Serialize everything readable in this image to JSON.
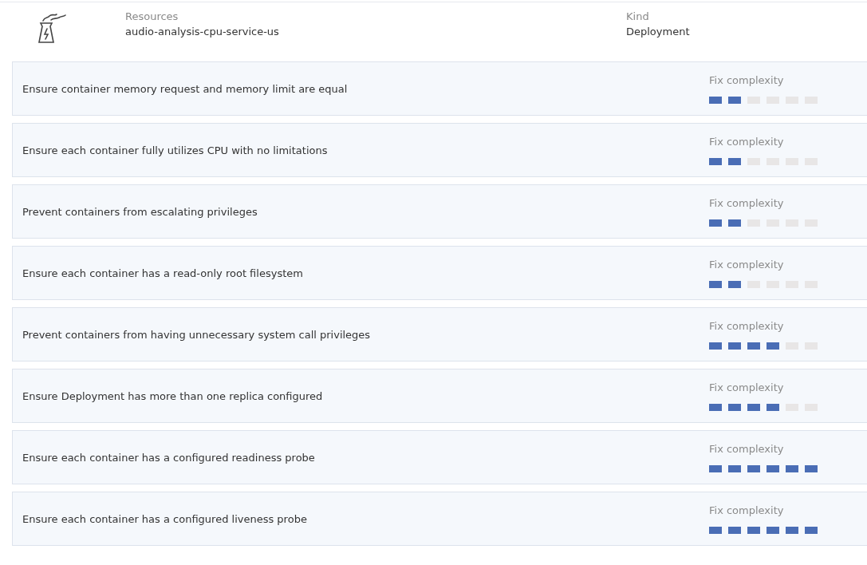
{
  "resource": {
    "label": "Resources",
    "value": "audio-analysis-cpu-service-us"
  },
  "kind": {
    "label": "Kind",
    "value": "Deployment"
  },
  "checks": [
    {
      "title": "Ensure container memory request and memory limit are equal",
      "complexity_label": "Fix complexity",
      "level": 0.3333
    },
    {
      "title": "Ensure each container fully utilizes CPU with no limitations",
      "complexity_label": "Fix complexity",
      "level": 0.3333
    },
    {
      "title": "Prevent containers from escalating privileges",
      "complexity_label": "Fix complexity",
      "level": 0.3333
    },
    {
      "title": "Ensure each container has a read-only root filesystem",
      "complexity_label": "Fix complexity",
      "level": 0.3333
    },
    {
      "title": "Prevent containers from having unnecessary system call privileges",
      "complexity_label": "Fix complexity",
      "level": 0.6667
    },
    {
      "title": "Ensure Deployment has more than one replica configured",
      "complexity_label": "Fix complexity",
      "level": 0.6667
    },
    {
      "title": "Ensure each container has a configured readiness probe",
      "complexity_label": "Fix complexity",
      "level": 1
    },
    {
      "title": "Ensure each container has a configured liveness probe",
      "complexity_label": "Fix complexity",
      "level": 1
    }
  ]
}
